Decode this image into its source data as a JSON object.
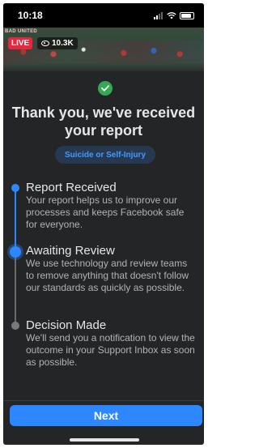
{
  "status_bar": {
    "time": "10:18"
  },
  "video": {
    "banner_text": "BAD UNITED",
    "live_label": "LIVE",
    "viewer_count": "10.3K"
  },
  "report": {
    "title": "Thank you, we've received your report",
    "category": "Suicide or Self-Injury"
  },
  "steps": [
    {
      "title": "Report Received",
      "description": "Your report helps us to improve our processes and keeps Facebook safe for everyone.",
      "state": "done"
    },
    {
      "title": "Awaiting Review",
      "description": "We use technology and review teams to remove anything that doesn't follow our standards as quickly as possible.",
      "state": "active"
    },
    {
      "title": "Decision Made",
      "description": "We'll send you a notification to view the outcome in your Support Inbox as soon as possible.",
      "state": "pending"
    }
  ],
  "footer": {
    "next_label": "Next"
  },
  "colors": {
    "accent": "#2d88ff",
    "success": "#35a853",
    "live": "#e4283d",
    "sheet": "#242526"
  }
}
